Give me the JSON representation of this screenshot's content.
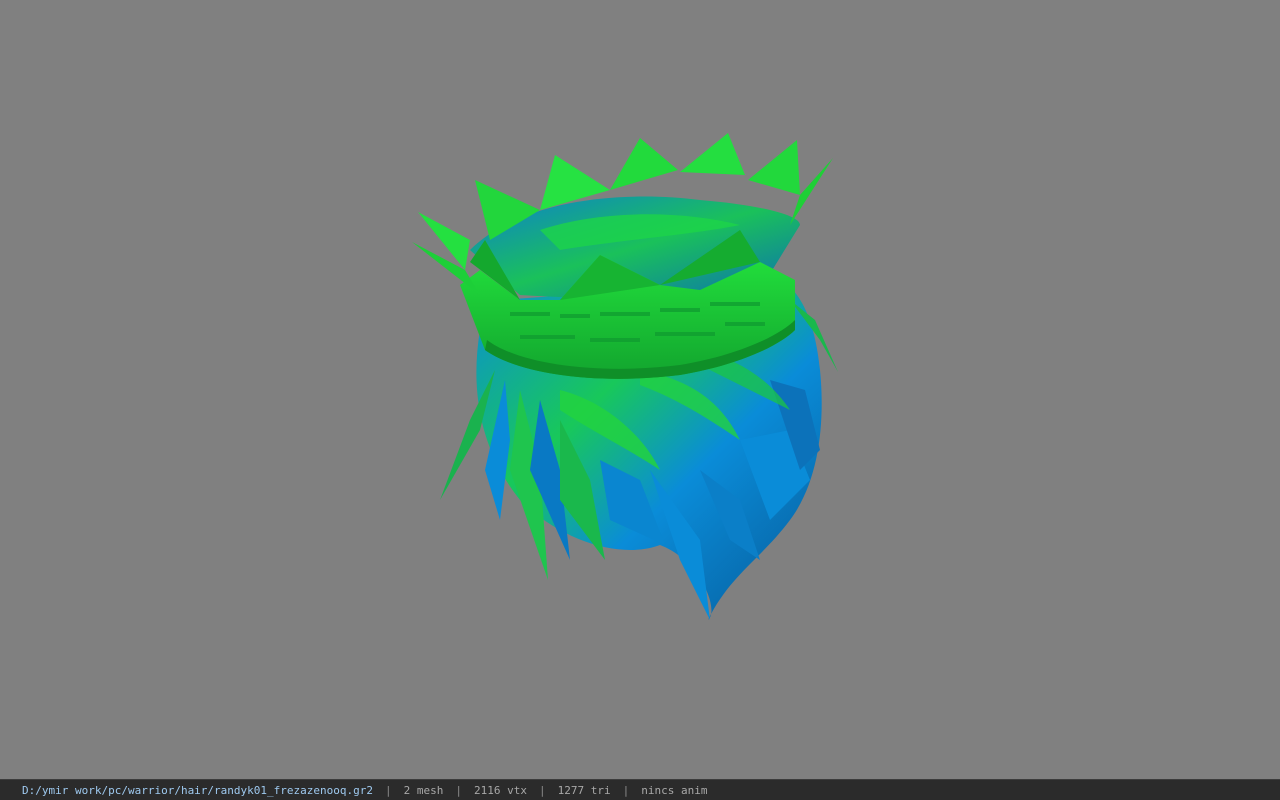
{
  "viewer": {
    "background_color": "#808080",
    "model": {
      "description_icon": "hair-crown-mesh",
      "colors": {
        "crown_green": "#1bd83a",
        "crown_dark_green": "#0f8f28",
        "hair_blue": "#0a8cd8",
        "hair_dark_blue": "#064f86"
      }
    }
  },
  "status_bar": {
    "file_path": "D:/ymir work/pc/warrior/hair/randyk01_frezazenooq.gr2",
    "sep1": "|",
    "mesh_count": "2 mesh",
    "sep2": "|",
    "vertex_count": "2116 vtx",
    "sep3": "|",
    "triangle_count": "1277 tri",
    "sep4": "|",
    "animation": "nincs anim"
  }
}
